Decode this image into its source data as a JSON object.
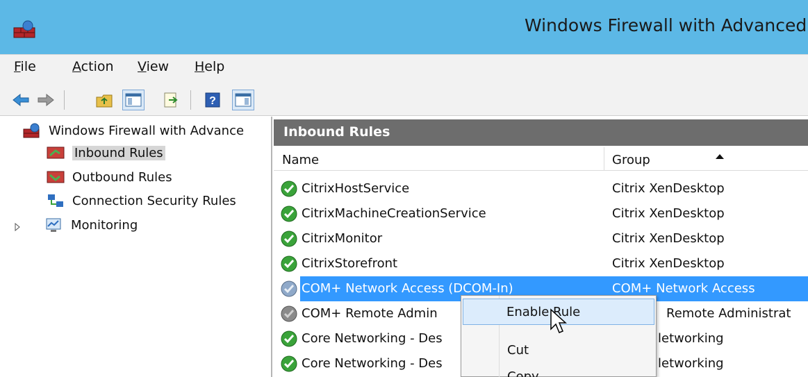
{
  "window": {
    "title": "Windows Firewall with Advanced"
  },
  "menu": {
    "items": [
      {
        "underline": "F",
        "rest": "ile"
      },
      {
        "underline": "A",
        "rest": "ction"
      },
      {
        "underline": "V",
        "rest": "iew"
      },
      {
        "underline": "H",
        "rest": "elp"
      }
    ]
  },
  "toolbar": {
    "icons": [
      "back-arrow-icon",
      "forward-arrow-icon",
      "up-folder-icon",
      "show-hide-console-tree-icon",
      "export-list-icon",
      "help-icon",
      "show-hide-action-pane-icon"
    ]
  },
  "tree": {
    "root": "Windows Firewall with Advance",
    "items": [
      "Inbound Rules",
      "Outbound Rules",
      "Connection Security Rules",
      "Monitoring"
    ]
  },
  "pane": {
    "header": "Inbound Rules",
    "columns": {
      "name": "Name",
      "group": "Group"
    },
    "rows": [
      {
        "name": "CitrixHostService",
        "group": "Citrix XenDesktop",
        "enabled": true
      },
      {
        "name": "CitrixMachineCreationService",
        "group": "Citrix XenDesktop",
        "enabled": true
      },
      {
        "name": "CitrixMonitor",
        "group": "Citrix XenDesktop",
        "enabled": true
      },
      {
        "name": "CitrixStorefront",
        "group": "Citrix XenDesktop",
        "enabled": true
      },
      {
        "name": "COM+ Network Access (DCOM-In)",
        "group": "COM+ Network Access",
        "enabled": false
      },
      {
        "name": "COM+ Remote Admin",
        "group": "Remote Administrat",
        "enabled": false
      },
      {
        "name": "Core Networking - Des",
        "group": "letworking",
        "enabled": true
      },
      {
        "name": "Core Networking - Des",
        "group": "letworking",
        "enabled": true
      }
    ]
  },
  "context_menu": {
    "items": [
      "Enable Rule",
      "Cut",
      "Copy"
    ]
  },
  "colors": {
    "titlebar": "#5cb8e6",
    "selection": "#3399ff",
    "pane_header": "#6d6d6d",
    "enabled_icon": "#3aa33a",
    "disabled_icon": "#8a8a8a"
  }
}
